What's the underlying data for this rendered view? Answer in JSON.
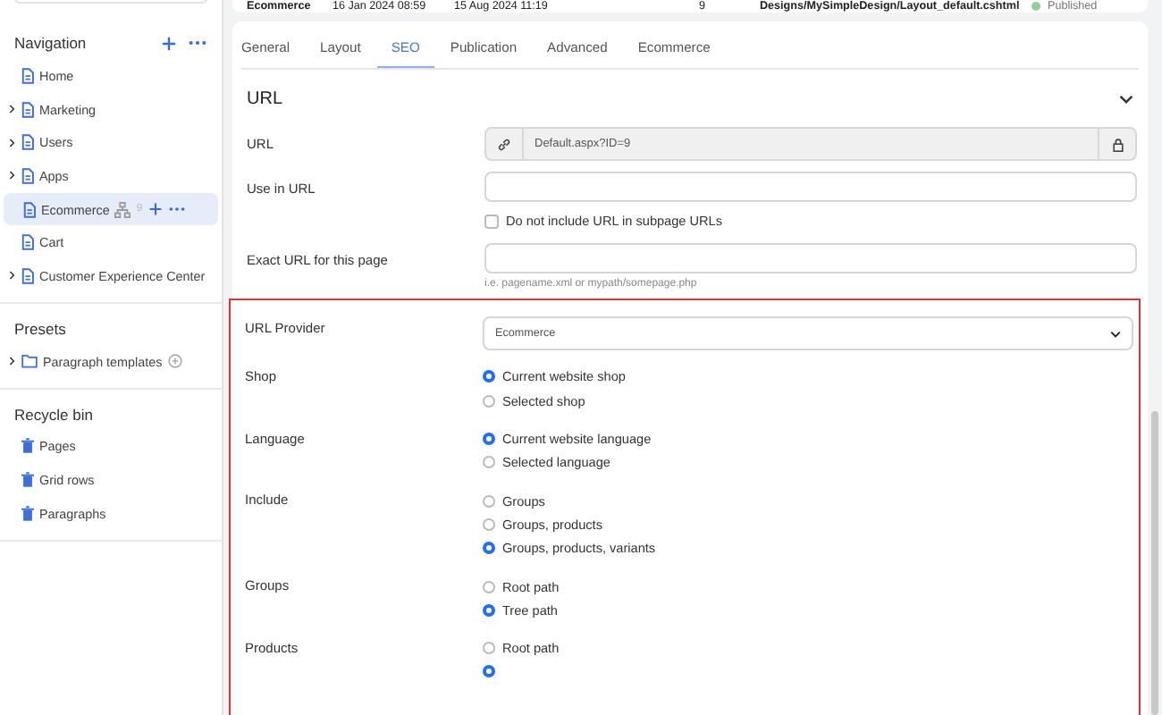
{
  "sidebar": {
    "sections": [
      {
        "title": "Navigation",
        "actions": true,
        "items": [
          {
            "label": "Home",
            "expandable": false,
            "selected": false,
            "kind": "page"
          },
          {
            "label": "Marketing",
            "expandable": true,
            "selected": false,
            "kind": "page"
          },
          {
            "label": "Users",
            "expandable": true,
            "selected": false,
            "kind": "page"
          },
          {
            "label": "Apps",
            "expandable": true,
            "selected": false,
            "kind": "page"
          },
          {
            "label": "Ecommerce",
            "expandable": false,
            "selected": true,
            "kind": "page",
            "id_badge": "9"
          },
          {
            "label": "Cart",
            "expandable": false,
            "selected": false,
            "kind": "page"
          },
          {
            "label": "Customer Experience Center",
            "expandable": true,
            "selected": false,
            "kind": "page"
          }
        ]
      },
      {
        "title": "Presets",
        "actions": false,
        "items": [
          {
            "label": "Paragraph templates",
            "expandable": true,
            "selected": false,
            "kind": "folder"
          }
        ]
      },
      {
        "title": "Recycle bin",
        "actions": false,
        "items": [
          {
            "label": "Pages",
            "expandable": false,
            "selected": false,
            "kind": "trash"
          },
          {
            "label": "Grid rows",
            "expandable": false,
            "selected": false,
            "kind": "trash"
          },
          {
            "label": "Paragraphs",
            "expandable": false,
            "selected": false,
            "kind": "trash"
          }
        ]
      }
    ]
  },
  "info_row": {
    "name": "Ecommerce",
    "created": "16 Jan 2024 08:59",
    "updated": "15 Aug 2024 11:19",
    "item_id": "9",
    "layout": "Designs/MySimpleDesign/Layout_default.cshtml",
    "status": "Published"
  },
  "tabs": [
    {
      "label": "General",
      "selected": false
    },
    {
      "label": "Layout",
      "selected": false
    },
    {
      "label": "SEO",
      "selected": true
    },
    {
      "label": "Publication",
      "selected": false
    },
    {
      "label": "Advanced",
      "selected": false
    },
    {
      "label": "Ecommerce",
      "selected": false
    }
  ],
  "section": {
    "title": "URL",
    "expanded": true
  },
  "fields": [
    {
      "kind": "locked",
      "label": "URL",
      "value": "Default.aspx?ID=9"
    },
    {
      "kind": "text",
      "label": "Use in URL"
    },
    {
      "kind": "checkbox",
      "text": "Do not include URL in subpage URLs",
      "checked": false
    },
    {
      "kind": "text",
      "label": "Exact URL for this page",
      "hint": "i.e. pagename.xml or mypath/somepage.php"
    }
  ],
  "provider": {
    "label": "URL Provider",
    "value": "Ecommerce"
  },
  "radio_groups": [
    {
      "label": "Shop",
      "options": [
        {
          "label": "Current website shop",
          "selected": true
        },
        {
          "label": "Selected shop",
          "selected": false
        }
      ]
    },
    {
      "label": "Language",
      "options": [
        {
          "label": "Current website language",
          "selected": true
        },
        {
          "label": "Selected language",
          "selected": false
        }
      ]
    },
    {
      "label": "Include",
      "options": [
        {
          "label": "Groups",
          "selected": false
        },
        {
          "label": "Groups, products",
          "selected": false
        },
        {
          "label": "Groups, products, variants",
          "selected": true
        }
      ]
    },
    {
      "label": "Groups",
      "options": [
        {
          "label": "Root path",
          "selected": false
        },
        {
          "label": "Tree path",
          "selected": true
        }
      ]
    },
    {
      "label": "Products",
      "options": [
        {
          "label": "Root path",
          "selected": false
        },
        {
          "selected": true
        }
      ]
    }
  ]
}
